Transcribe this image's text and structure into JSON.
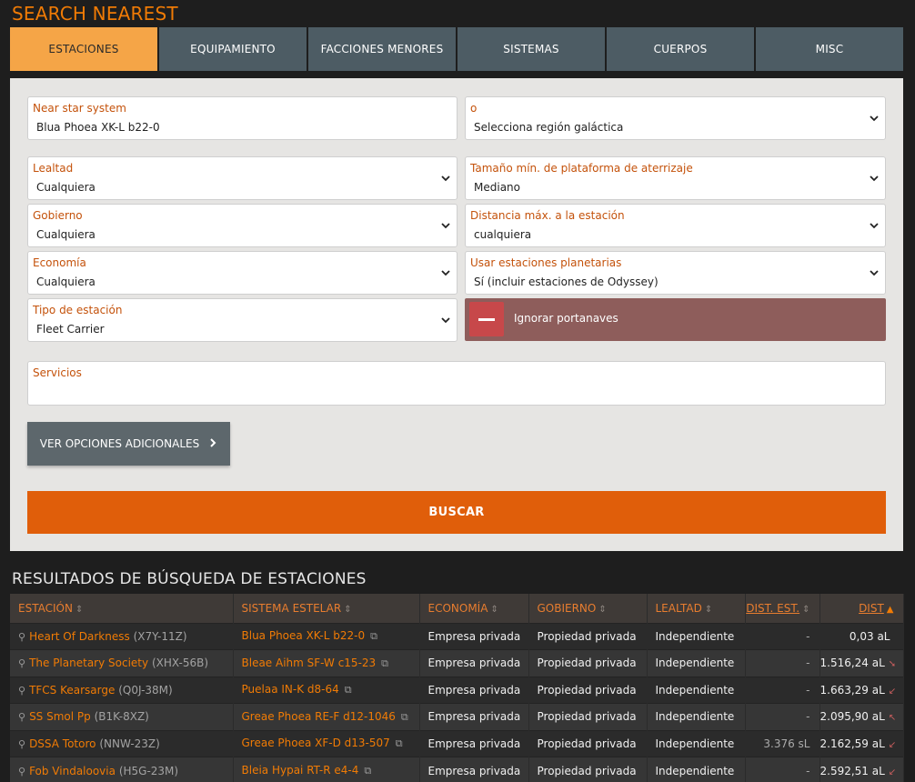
{
  "title": "SEARCH NEAREST",
  "tabs": [
    {
      "label": "ESTACIONES",
      "active": true
    },
    {
      "label": "EQUIPAMIENTO",
      "active": false
    },
    {
      "label": "FACCIONES MENORES",
      "active": false
    },
    {
      "label": "SISTEMAS",
      "active": false
    },
    {
      "label": "CUERPOS",
      "active": false
    },
    {
      "label": "MISC",
      "active": false
    }
  ],
  "form": {
    "near_label": "Near star system",
    "near_value": "Blua Phoea XK-L b22-0",
    "region_label": "o",
    "region_value": "Selecciona región galáctica",
    "lealtad_label": "Lealtad",
    "lealtad_value": "Cualquiera",
    "plataforma_label": "Tamaño mín. de plataforma de aterrizaje",
    "plataforma_value": "Mediano",
    "gobierno_label": "Gobierno",
    "gobierno_value": "Cualquiera",
    "distancia_label": "Distancia máx. a la estación",
    "distancia_value": "cualquiera",
    "economia_label": "Economía",
    "economia_value": "Cualquiera",
    "planetarias_label": "Usar estaciones planetarias",
    "planetarias_value": "Sí (incluir estaciones de Odyssey)",
    "tipo_label": "Tipo de estación",
    "tipo_value": "Fleet Carrier",
    "ignorar_label": "Ignorar portanaves",
    "servicios_label": "Servicios",
    "more_label": "VER OPCIONES ADICIONALES",
    "search_label": "BUSCAR"
  },
  "results": {
    "title": "RESULTADOS DE BÚSQUEDA DE ESTACIONES",
    "headers": [
      "ESTACIÓN",
      "SISTEMA ESTELAR",
      "ECONOMÍA",
      "GOBIERNO",
      "LEALTAD",
      "DIST. EST.",
      "DIST"
    ],
    "rows": [
      {
        "station": "Heart Of Darkness",
        "code": "(X7Y-11Z)",
        "system": "Blua Phoea XK-L b22-0",
        "economy": "Empresa privada",
        "government": "Propiedad privada",
        "allegiance": "Independiente",
        "dist_st": "-",
        "dist": "0,03 aL",
        "dir": ""
      },
      {
        "station": "The Planetary Society",
        "code": "(XHX-56B)",
        "system": "Bleae Aihm SF-W c15-23",
        "economy": "Empresa privada",
        "government": "Propiedad privada",
        "allegiance": "Independiente",
        "dist_st": "-",
        "dist": "1.516,24 aL",
        "dir": "➘"
      },
      {
        "station": "TFCS Kearsarge",
        "code": "(Q0J-38M)",
        "system": "Puelaa IN-K d8-64",
        "economy": "Empresa privada",
        "government": "Propiedad privada",
        "allegiance": "Independiente",
        "dist_st": "-",
        "dist": "1.663,29 aL",
        "dir": "↙"
      },
      {
        "station": "SS Smol Pp",
        "code": "(B1K-8XZ)",
        "system": "Greae Phoea RE-F d12-1046",
        "economy": "Empresa privada",
        "government": "Propiedad privada",
        "allegiance": "Independiente",
        "dist_st": "-",
        "dist": "2.095,90 aL",
        "dir": "↖"
      },
      {
        "station": "DSSA Totoro",
        "code": "(NNW-23Z)",
        "system": "Greae Phoea XF-D d13-507",
        "economy": "Empresa privada",
        "government": "Propiedad privada",
        "allegiance": "Independiente",
        "dist_st": "3.376 sL",
        "dist": "2.162,59 aL",
        "dir": "↙"
      },
      {
        "station": "Fob Vindaloovia",
        "code": "(H5G-23M)",
        "system": "Bleia Hypai RT-R e4-4",
        "economy": "Empresa privada",
        "government": "Propiedad privada",
        "allegiance": "Independiente",
        "dist_st": "-",
        "dist": "2.592,51 aL",
        "dir": "↙"
      }
    ]
  }
}
